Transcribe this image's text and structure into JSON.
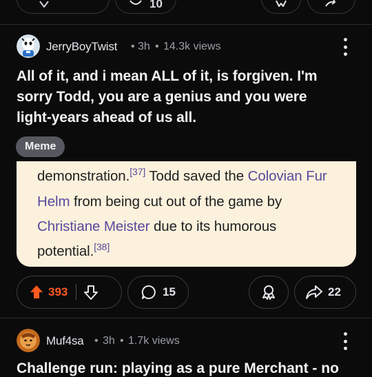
{
  "previous_post": {
    "comment_count_partial": "10"
  },
  "post": {
    "username": "JerryBoyTwist",
    "age": "3h",
    "views": "14.3k views",
    "title_lines": [
      "All of it, and i mean ALL of it, is forgiven. I'm",
      "sorry Todd, you are a genius and you were",
      "light-years ahead of us all."
    ],
    "flair": "Meme",
    "excerpt": {
      "w1": "demonstration.",
      "ref1": "[37]",
      "w2": " Todd saved the ",
      "link1": "Colovian Fur",
      "link1b": "Helm",
      "w3": " from being cut out of the game by",
      "link2": "Christiane Meister",
      "w4": " due to its humorous",
      "w5": "potential.",
      "ref2": "[38]"
    },
    "upvotes": "393",
    "comments": "15",
    "shares": "22"
  },
  "next_post": {
    "username": "Muf4sa",
    "age": "3h",
    "views": "1.7k views",
    "title_partial": "Challenge run: playing as a pure Merchant - no"
  },
  "colors": {
    "background": "#0b0b0c",
    "upvote_active": "#ff5a1f",
    "flair_bg": "#55595f",
    "excerpt_bg": "#fbf1dc",
    "wiki_link": "#5a4a9e"
  },
  "icons": {
    "upvote": "upvote-arrow-icon",
    "downvote": "downvote-arrow-icon",
    "comment": "speech-bubble-icon",
    "award": "award-ribbon-icon",
    "share": "share-arrow-icon",
    "more": "kebab-menu-icon"
  }
}
